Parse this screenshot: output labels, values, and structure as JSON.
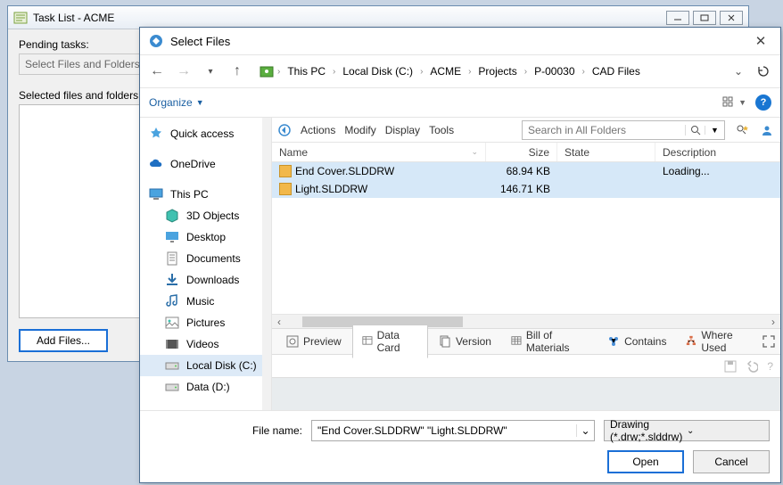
{
  "bgWindow": {
    "title": "Task List - ACME",
    "pendingLabel": "Pending tasks:",
    "readonlyText": "Select Files and Folders f",
    "selectedLabel": "Selected files and folders:",
    "addFilesLabel": "Add Files..."
  },
  "dialog": {
    "title": "Select Files",
    "breadcrumb": [
      "This PC",
      "Local Disk (C:)",
      "ACME",
      "Projects",
      "P-00030",
      "CAD Files"
    ],
    "organize": "Organize",
    "actionbar": {
      "actions": "Actions",
      "modify": "Modify",
      "display": "Display",
      "tools": "Tools"
    },
    "searchPlaceholder": "Search in All Folders",
    "columns": {
      "name": "Name",
      "size": "Size",
      "state": "State",
      "desc": "Description"
    },
    "files": [
      {
        "name": "End Cover.SLDDRW",
        "size": "68.94 KB",
        "state": "",
        "desc": "Loading..."
      },
      {
        "name": "Light.SLDDRW",
        "size": "146.71 KB",
        "state": "",
        "desc": ""
      }
    ],
    "tabs": {
      "preview": "Preview",
      "datacard": "Data Card",
      "version": "Version",
      "bom": "Bill of Materials",
      "contains": "Contains",
      "whereused": "Where Used"
    },
    "fileNameLabel": "File name:",
    "fileNameValue": "\"End Cover.SLDDRW\" \"Light.SLDDRW\"",
    "filterLabel": "Drawing (*.drw;*.slddrw)",
    "openLabel": "Open",
    "cancelLabel": "Cancel"
  },
  "tree": [
    {
      "label": "Quick access",
      "icon": "star",
      "indent": false
    },
    {
      "spacer": true
    },
    {
      "label": "OneDrive",
      "icon": "cloud",
      "indent": false
    },
    {
      "spacer": true
    },
    {
      "label": "This PC",
      "icon": "pc",
      "indent": false
    },
    {
      "label": "3D Objects",
      "icon": "cube",
      "indent": true
    },
    {
      "label": "Desktop",
      "icon": "desktop",
      "indent": true
    },
    {
      "label": "Documents",
      "icon": "doc",
      "indent": true
    },
    {
      "label": "Downloads",
      "icon": "download",
      "indent": true
    },
    {
      "label": "Music",
      "icon": "music",
      "indent": true
    },
    {
      "label": "Pictures",
      "icon": "pic",
      "indent": true
    },
    {
      "label": "Videos",
      "icon": "video",
      "indent": true
    },
    {
      "label": "Local Disk (C:)",
      "icon": "disk",
      "indent": true,
      "selected": true
    },
    {
      "label": "Data (D:)",
      "icon": "disk",
      "indent": true
    }
  ]
}
